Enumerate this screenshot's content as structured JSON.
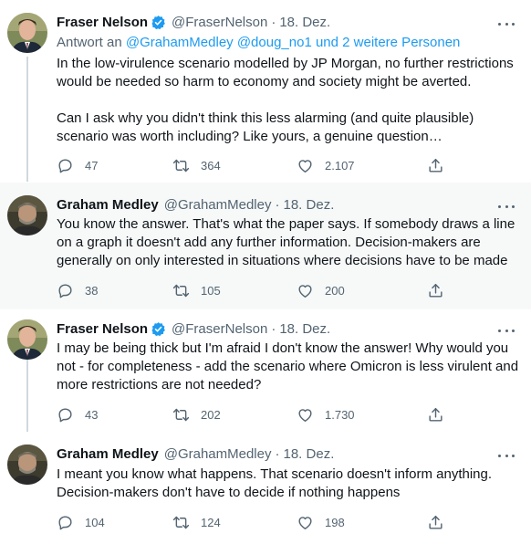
{
  "tweets": [
    {
      "name": "Fraser Nelson",
      "verified": true,
      "handle": "@FraserNelson",
      "sep": "·",
      "date": "18. Dez.",
      "reply_prefix": "Antwort an",
      "reply_targets": "@GrahamMedley @doug_no1 und 2 weitere Personen",
      "paragraphs": [
        "In the low-virulence scenario modelled by JP Morgan, no further restrictions would be needed so harm to economy and society might be averted.",
        "Can I ask why you didn't think this less alarming (and quite plausible) scenario was worth including? Like yours, a genuine question…"
      ],
      "replies": "47",
      "retweets": "364",
      "likes": "2.107"
    },
    {
      "name": "Graham Medley",
      "verified": false,
      "handle": "@GrahamMedley",
      "sep": "·",
      "date": "18. Dez.",
      "paragraphs": [
        "You know the answer. That's what the paper says. If somebody draws a line on a graph it doesn't add any further information. Decision-makers are generally on only interested in situations where decisions have to be made"
      ],
      "replies": "38",
      "retweets": "105",
      "likes": "200"
    },
    {
      "name": "Fraser Nelson",
      "verified": true,
      "handle": "@FraserNelson",
      "sep": "·",
      "date": "18. Dez.",
      "paragraphs": [
        "I may be being thick but I'm afraid I don't know the answer! Why would you not - for completeness - add the scenario where Omicron is less virulent and more restrictions are not needed?"
      ],
      "replies": "43",
      "retweets": "202",
      "likes": "1.730"
    },
    {
      "name": "Graham Medley",
      "verified": false,
      "handle": "@GrahamMedley",
      "sep": "·",
      "date": "18. Dez.",
      "paragraphs": [
        "I meant you know what happens. That scenario doesn't inform anything. Decision-makers don't have to decide if nothing happens"
      ],
      "replies": "104",
      "retweets": "124",
      "likes": "198"
    }
  ],
  "icons": {
    "reply": "reply-icon",
    "retweet": "retweet-icon",
    "like": "like-icon",
    "share": "share-icon",
    "more": "more-icon",
    "verified": "verified-badge-icon"
  },
  "colors": {
    "link": "#1d9bf0",
    "muted": "#536471",
    "text": "#0f1419",
    "highlight_bg": "#f7f9f9",
    "thread_line": "#cfd9de"
  }
}
